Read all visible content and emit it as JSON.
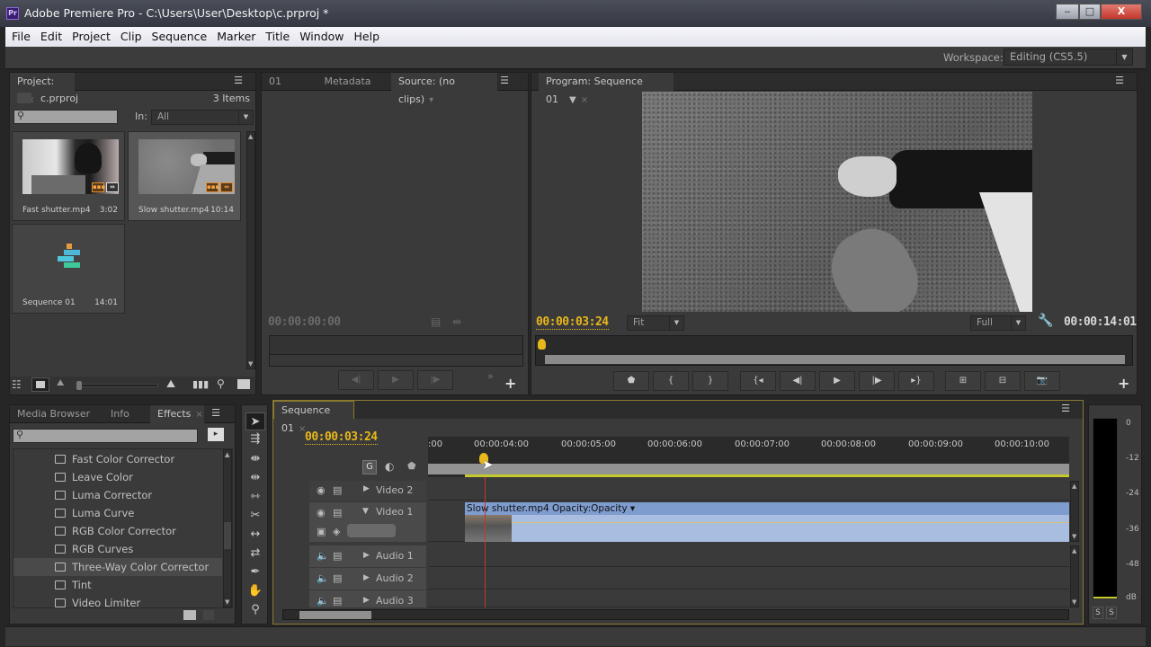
{
  "window": {
    "title": "Adobe Premiere Pro - C:\\Users\\User\\Desktop\\c.prproj *",
    "app_icon": "Pr",
    "controls": {
      "minimize": "‒",
      "maximize": "□",
      "close": "X"
    }
  },
  "menu": [
    "File",
    "Edit",
    "Project",
    "Clip",
    "Sequence",
    "Marker",
    "Title",
    "Window",
    "Help"
  ],
  "workspace": {
    "label": "Workspace:",
    "value": "Editing (CS5.5)"
  },
  "project_panel": {
    "tab": "Project: c",
    "project_file": "c.prproj",
    "item_count": "3 Items",
    "search_placeholder": "",
    "in_label": "In:",
    "in_value": "All",
    "items": [
      {
        "name": "Fast shutter.mp4",
        "duration": "3:02",
        "type": "clip"
      },
      {
        "name": "Slow shutter.mp4",
        "duration": "10:14",
        "type": "clip",
        "selected": true
      },
      {
        "name": "Sequence 01",
        "duration": "14:01",
        "type": "sequence"
      }
    ],
    "zoom_slider": 0.02
  },
  "source_panel": {
    "tabs": [
      "01",
      "Metadata",
      "Source: (no clips)"
    ],
    "timecode": "00:00:00:00",
    "controls": {
      "step_back": "◀|",
      "play": "▶",
      "step_forward": "|▶",
      "more": "»",
      "add": "+"
    }
  },
  "program_panel": {
    "tab": "Program: Sequence 01",
    "timecode_current": "00:00:03:24",
    "fit": "Fit",
    "quality": "Full",
    "timecode_duration": "00:00:14:01",
    "playhead_fraction": 0.0,
    "buttons": [
      "Add Marker",
      "Mark In",
      "Mark Out",
      "Go to In",
      "Step Back",
      "Play-Stop",
      "Step Forward",
      "Go to Out",
      "Lift",
      "Extract",
      "Export Frame"
    ]
  },
  "effects_panel": {
    "tabs": [
      "Media Browser",
      "Info",
      "Effects"
    ],
    "search_placeholder": "",
    "items": [
      "Fast Color Corrector",
      "Leave Color",
      "Luma Corrector",
      "Luma Curve",
      "RGB Color Corrector",
      "RGB Curves",
      "Three-Way Color Corrector",
      "Tint",
      "Video Limiter"
    ],
    "highlighted": "Three-Way Color Corrector"
  },
  "tools": [
    "Selection",
    "Track Select",
    "Ripple Edit",
    "Rolling Edit",
    "Rate Stretch",
    "Razor",
    "Slip",
    "Slide",
    "Pen",
    "Hand",
    "Zoom"
  ],
  "timeline": {
    "tab": "Sequence 01",
    "timecode": "00:00:03:24",
    "ruler_labels": [
      ":00",
      "00:00:04:00",
      "00:00:05:00",
      "00:00:06:00",
      "00:00:07:00",
      "00:00:08:00",
      "00:00:09:00",
      "00:00:10:00"
    ],
    "tracks": [
      {
        "name": "Video 2",
        "kind": "video",
        "expanded": false
      },
      {
        "name": "Video 1",
        "kind": "video",
        "expanded": true
      },
      {
        "name": "Audio 1",
        "kind": "audio",
        "expanded": false
      },
      {
        "name": "Audio 2",
        "kind": "audio",
        "expanded": false
      },
      {
        "name": "Audio 3",
        "kind": "audio",
        "expanded": false
      }
    ],
    "clip": {
      "name": "Slow shutter.mp4",
      "effect_menu": "Opacity:Opacity"
    }
  },
  "audio_meter": {
    "db_labels": [
      "0",
      "-12",
      "-24",
      "-36",
      "-48",
      "dB"
    ],
    "solo_buttons": [
      "S",
      "S"
    ]
  },
  "colors": {
    "accent_timecode": "#e8b71b",
    "clip_fill": "#a8bde0",
    "clip_header": "#7f9ccf",
    "playhead": "#c0392b",
    "work_area": "#c4c82c"
  }
}
